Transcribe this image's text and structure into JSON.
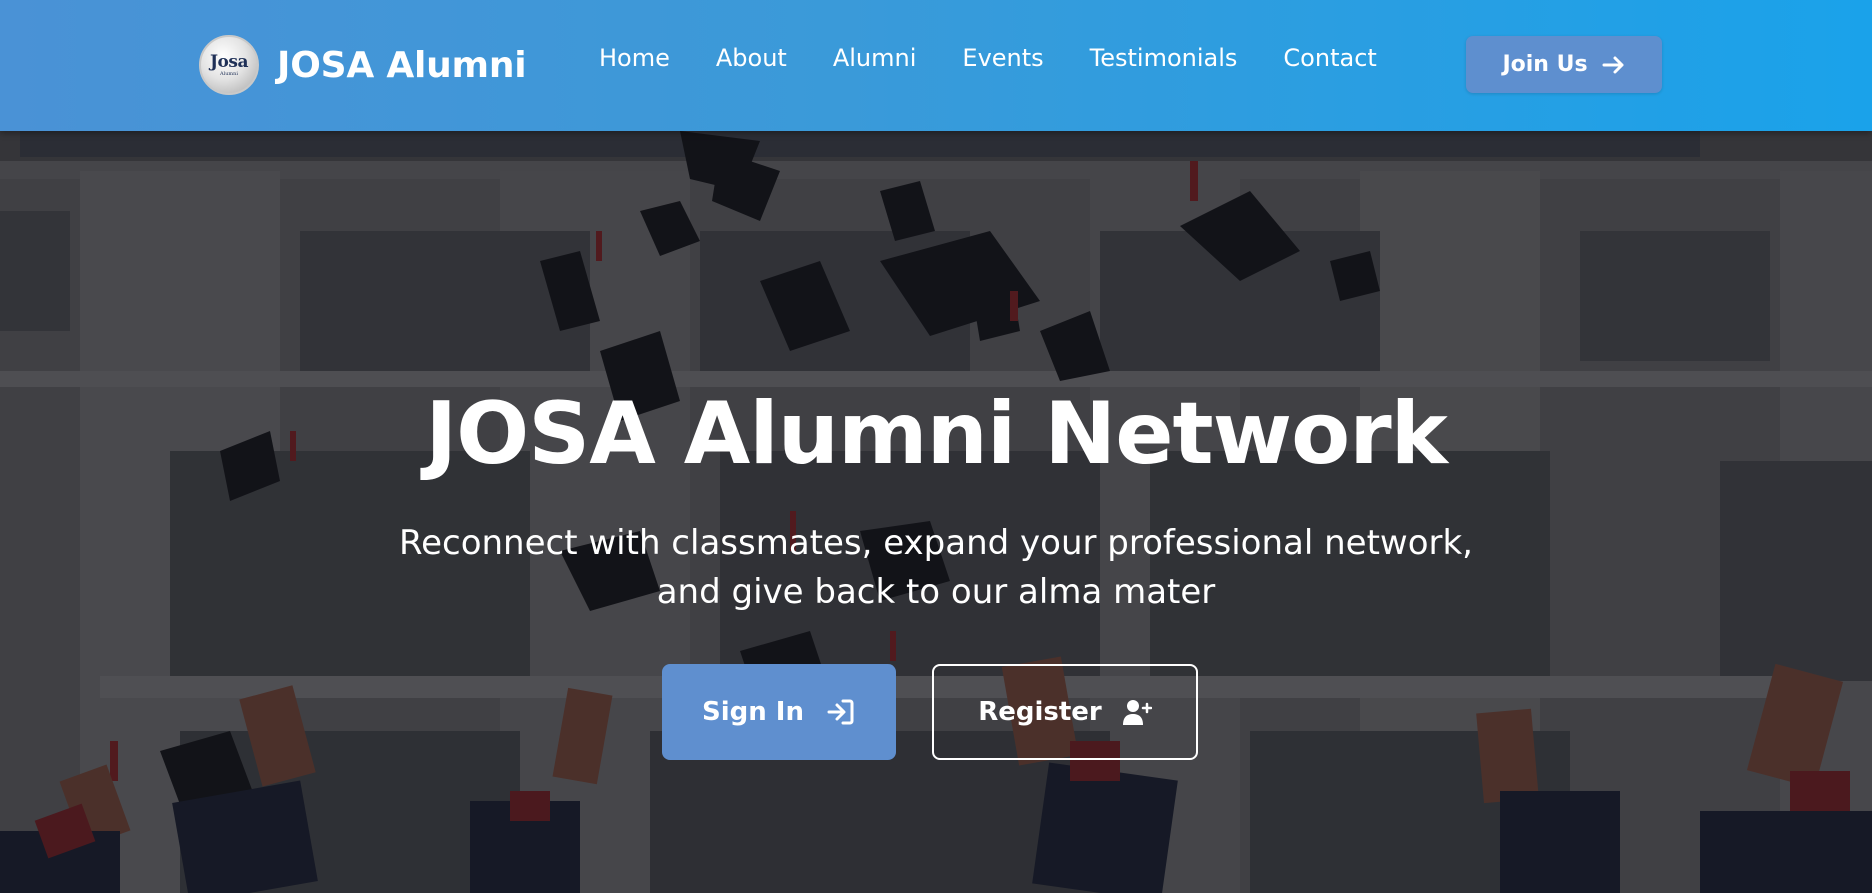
{
  "navbar": {
    "logo": {
      "text": "Josa",
      "subtext": "Alumni",
      "icon": "josa-logo"
    },
    "brand_name": "JOSA Alumni",
    "links": [
      {
        "label": "Home"
      },
      {
        "label": "About"
      },
      {
        "label": "Alumni"
      },
      {
        "label": "Events"
      },
      {
        "label": "Testimonials"
      },
      {
        "label": "Contact"
      }
    ],
    "join_button": {
      "label": "Join Us",
      "icon": "arrow-right-icon"
    },
    "colors": {
      "gradient_start": "#4a92d6",
      "gradient_end": "#1aa2ea",
      "button": "#5e8fcf"
    }
  },
  "hero": {
    "background": "graduation-caps-thrown-building-photo",
    "title": "JOSA Alumni Network",
    "subtitle_line1": "Reconnect with classmates, expand your professional network,",
    "subtitle_line2": "and give back to our alma mater",
    "signin_button": {
      "label": "Sign In",
      "icon": "sign-in-icon"
    },
    "register_button": {
      "label": "Register",
      "icon": "user-plus-icon"
    },
    "colors": {
      "primary_button": "#5f8fcf",
      "overlay": "#121216"
    }
  }
}
